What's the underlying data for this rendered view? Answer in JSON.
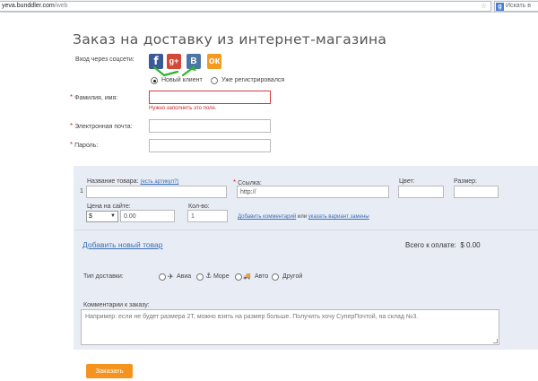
{
  "browser": {
    "url_host": "yeva.bunddler.com",
    "url_path": "/web",
    "search_placeholder": "Искать в"
  },
  "page": {
    "title": "Заказ на доставку из интернет-магазина"
  },
  "social": {
    "label": "Вход через соцсети:",
    "icons": [
      {
        "name": "facebook-icon",
        "glyph": "f",
        "color": "#3b5998"
      },
      {
        "name": "google-plus-icon",
        "glyph": "g+",
        "color": "#d34836"
      },
      {
        "name": "vkontakte-icon",
        "glyph": "B",
        "color": "#4c75a3"
      },
      {
        "name": "odnoklassniki-icon",
        "glyph": "ок",
        "color": "#f39a21"
      }
    ]
  },
  "client_type": {
    "new_client": "Новый клиент",
    "registered": "Уже регистрировался",
    "selected": "new_client"
  },
  "form": {
    "name_label": "Фамилия, имя:",
    "name_error": "Нужно заполнить это поле.",
    "email_label": "Электронная почта:",
    "password_label": "Пароль:",
    "required_mark": "*"
  },
  "product": {
    "row_number": "1",
    "name_label": "Название товара:",
    "name_hint": "(есть артикул?)",
    "link_label": "Ссылка:",
    "link_value": "http://",
    "color_label": "Цвет:",
    "size_label": "Размер:",
    "price_label": "Цена на сайте:",
    "currency_value": "$",
    "price_value": "0.00",
    "qty_label": "Кол-во:",
    "qty_value": "1",
    "add_comment": "Добавить комментарий",
    "or": "или",
    "replacement": "указать вариант замены"
  },
  "cart": {
    "add_product": "Добавить новый товар",
    "total_label": "Всего к оплате:",
    "total_value": "$ 0.00"
  },
  "delivery": {
    "label": "Тип доставки:",
    "options": [
      {
        "label": "Авиа",
        "icon": "plane-icon",
        "glyph": "✈"
      },
      {
        "label": "Море",
        "icon": "anchor-icon",
        "glyph": "⚓"
      },
      {
        "label": "Авто",
        "icon": "truck-icon",
        "glyph": "🚚"
      },
      {
        "label": "Другой",
        "icon": "",
        "glyph": ""
      }
    ]
  },
  "comments": {
    "label": "Комментарии к заказу:",
    "placeholder": "Например: если не будет размера 2T, можно взять на размер больше. Получить хочу СуперПочтой, на склад №3."
  },
  "submit": {
    "label": "Заказать"
  },
  "colors": {
    "accent": "#f5931f",
    "error": "#d12a2a",
    "panel": "#e8edf5",
    "link": "#3a6fb5"
  }
}
